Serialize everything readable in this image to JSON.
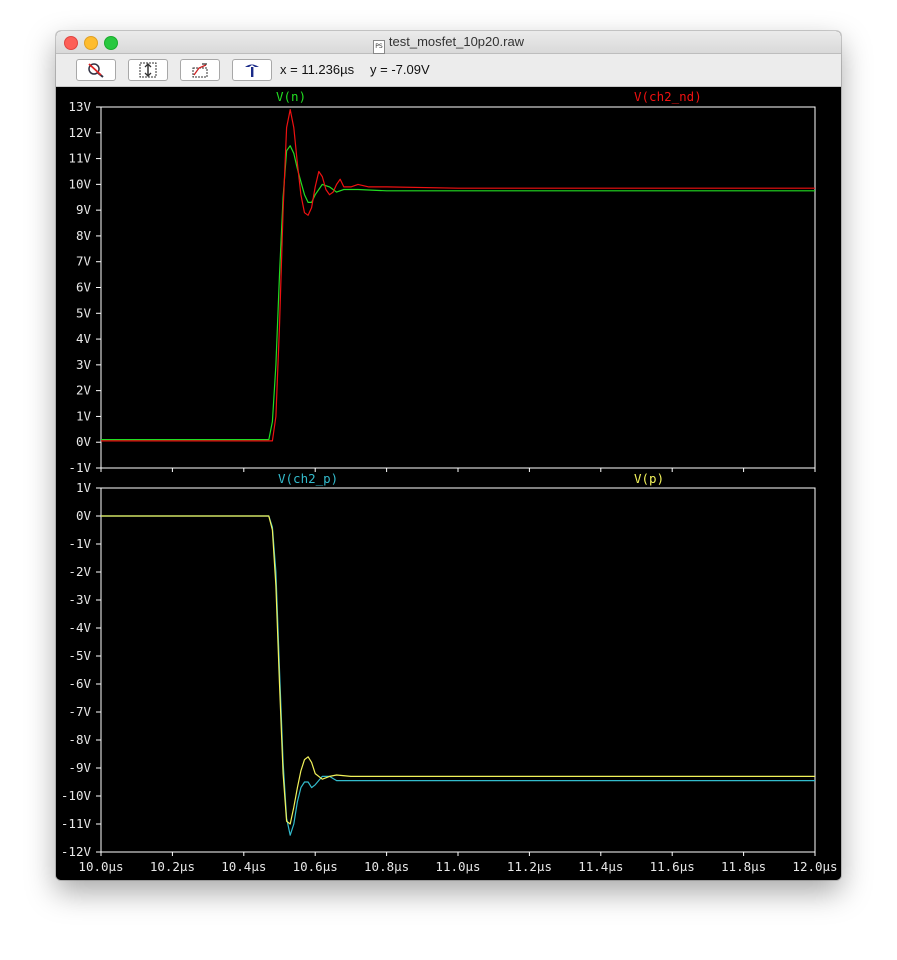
{
  "window": {
    "title": "test_mosfet_10p20.raw",
    "file_icon": "PS"
  },
  "toolbar": {
    "buttons": [
      {
        "name": "zoom-reset-icon"
      },
      {
        "name": "zoom-y-icon"
      },
      {
        "name": "zoom-x-icon"
      },
      {
        "name": "crosshair-cursor-icon"
      }
    ],
    "x_readout": "x = 11.236µs",
    "y_readout": "y = -7.09V"
  },
  "colors": {
    "background": "#000000",
    "axis": "#ffffff",
    "v_n": "#22dd22",
    "v_ch2_nd": "#ee1111",
    "v_ch2_p": "#33bbcc",
    "v_p": "#f2f25a"
  },
  "chart_data": [
    {
      "type": "line",
      "title": "",
      "xlabel": "",
      "ylabel": "",
      "xlim": [
        10.0,
        12.0
      ],
      "ylim": [
        -1,
        13
      ],
      "y_ticks": [
        "13V",
        "12V",
        "11V",
        "10V",
        "9V",
        "8V",
        "7V",
        "6V",
        "5V",
        "4V",
        "3V",
        "2V",
        "1V",
        "0V",
        "-1V"
      ],
      "legend_placement": "top",
      "series": [
        {
          "name": "V(n)",
          "color": "#22dd22",
          "x": [
            10.0,
            10.47,
            10.48,
            10.49,
            10.5,
            10.51,
            10.52,
            10.53,
            10.54,
            10.55,
            10.56,
            10.57,
            10.58,
            10.59,
            10.6,
            10.62,
            10.64,
            10.66,
            10.68,
            10.72,
            10.8,
            11.0,
            11.5,
            12.0
          ],
          "y": [
            0.1,
            0.1,
            0.8,
            3.0,
            6.5,
            9.5,
            11.3,
            11.5,
            11.2,
            10.6,
            10.1,
            9.6,
            9.3,
            9.3,
            9.6,
            10.0,
            9.9,
            9.7,
            9.8,
            9.8,
            9.75,
            9.75,
            9.75,
            9.75
          ]
        },
        {
          "name": "V(ch2_nd)",
          "color": "#ee1111",
          "x": [
            10.0,
            10.48,
            10.49,
            10.5,
            10.51,
            10.52,
            10.53,
            10.54,
            10.55,
            10.56,
            10.57,
            10.58,
            10.59,
            10.6,
            10.61,
            10.62,
            10.63,
            10.64,
            10.65,
            10.66,
            10.67,
            10.68,
            10.7,
            10.72,
            10.75,
            10.8,
            11.0,
            11.5,
            12.0
          ],
          "y": [
            0.05,
            0.05,
            1.0,
            4.5,
            9.0,
            12.2,
            12.9,
            12.2,
            10.8,
            9.6,
            8.9,
            8.8,
            9.1,
            9.9,
            10.5,
            10.3,
            9.8,
            9.6,
            9.7,
            10.0,
            10.2,
            9.9,
            9.9,
            10.0,
            9.9,
            9.9,
            9.85,
            9.85,
            9.85
          ]
        }
      ]
    },
    {
      "type": "line",
      "title": "",
      "xlabel": "",
      "ylabel": "",
      "xlim": [
        10.0,
        12.0
      ],
      "ylim": [
        -12,
        1
      ],
      "y_ticks": [
        "1V",
        "0V",
        "-1V",
        "-2V",
        "-3V",
        "-4V",
        "-5V",
        "-6V",
        "-7V",
        "-8V",
        "-9V",
        "-10V",
        "-11V",
        "-12V"
      ],
      "x_ticks": [
        "10.0µs",
        "10.2µs",
        "10.4µs",
        "10.6µs",
        "10.8µs",
        "11.0µs",
        "11.2µs",
        "11.4µs",
        "11.6µs",
        "11.8µs",
        "12.0µs"
      ],
      "legend_placement": "top",
      "series": [
        {
          "name": "V(ch2_p)",
          "color": "#33bbcc",
          "x": [
            10.0,
            10.47,
            10.48,
            10.49,
            10.5,
            10.51,
            10.52,
            10.53,
            10.54,
            10.55,
            10.56,
            10.57,
            10.58,
            10.59,
            10.6,
            10.62,
            10.64,
            10.66,
            10.7,
            10.8,
            11.0,
            11.5,
            12.0
          ],
          "y": [
            0,
            0,
            -0.4,
            -2.0,
            -5.5,
            -8.8,
            -10.8,
            -11.4,
            -11.0,
            -10.2,
            -9.7,
            -9.5,
            -9.5,
            -9.7,
            -9.6,
            -9.3,
            -9.3,
            -9.45,
            -9.45,
            -9.45,
            -9.45,
            -9.45,
            -9.45
          ]
        },
        {
          "name": "V(p)",
          "color": "#f2f25a",
          "x": [
            10.0,
            10.47,
            10.48,
            10.49,
            10.5,
            10.51,
            10.52,
            10.53,
            10.54,
            10.55,
            10.56,
            10.57,
            10.58,
            10.59,
            10.6,
            10.62,
            10.64,
            10.66,
            10.7,
            10.8,
            11.0,
            11.5,
            12.0
          ],
          "y": [
            0,
            0,
            -0.5,
            -2.5,
            -6.0,
            -9.2,
            -10.9,
            -11.0,
            -10.4,
            -9.7,
            -9.1,
            -8.7,
            -8.6,
            -8.8,
            -9.2,
            -9.4,
            -9.3,
            -9.25,
            -9.3,
            -9.3,
            -9.3,
            -9.3,
            -9.3
          ]
        }
      ]
    }
  ]
}
